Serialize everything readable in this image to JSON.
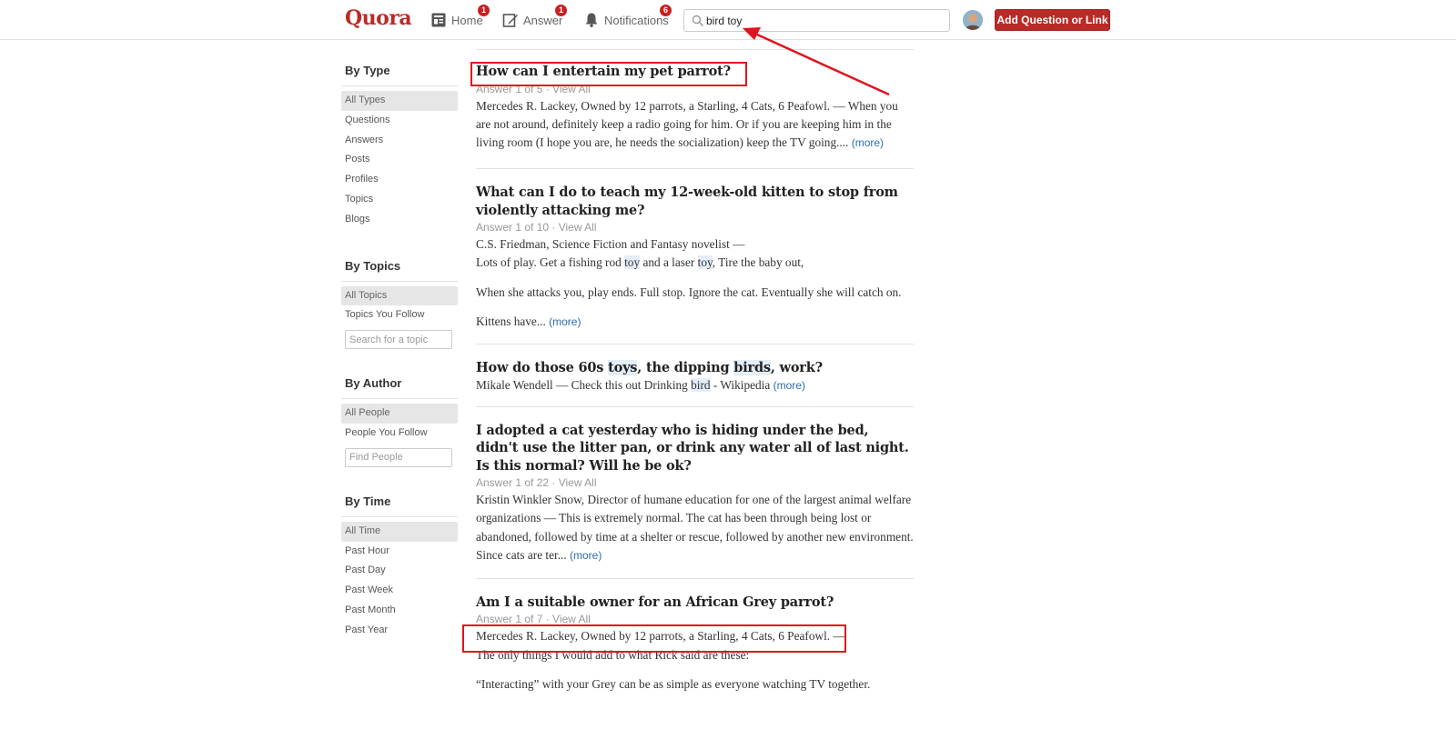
{
  "header": {
    "logo": "Quora",
    "nav": {
      "home": {
        "label": "Home",
        "badge": "1",
        "icon": "feed-icon"
      },
      "answer": {
        "label": "Answer",
        "badge": "1",
        "icon": "pencil-icon"
      },
      "notifications": {
        "label": "Notifications",
        "badge": "6",
        "icon": "bell-icon"
      }
    },
    "search": {
      "value": "bird toy",
      "icon": "search-icon"
    },
    "add_button": "Add Question or Link"
  },
  "sidebar": {
    "by_type": {
      "title": "By Type",
      "items": [
        "All Types",
        "Questions",
        "Answers",
        "Posts",
        "Profiles",
        "Topics",
        "Blogs"
      ]
    },
    "by_topics": {
      "title": "By Topics",
      "items": [
        "All Topics",
        "Topics You Follow"
      ],
      "search_placeholder": "Search for a topic"
    },
    "by_author": {
      "title": "By Author",
      "items": [
        "All People",
        "People You Follow"
      ],
      "search_placeholder": "Find People"
    },
    "by_time": {
      "title": "By Time",
      "items": [
        "All Time",
        "Past Hour",
        "Past Day",
        "Past Week",
        "Past Month",
        "Past Year"
      ]
    }
  },
  "results": [
    {
      "title": "How can I entertain my pet parrot?",
      "meta": "Answer 1 of 5 · View All",
      "author": "Mercedes R. Lackey, Owned by 12 parrots, a Starling, 4 Cats, 6 Peafowl. —",
      "text": "When you are not around, definitely keep a radio going for him. Or if you are keeping him in the living room (I hope you are, he needs the socialization) keep the TV going....",
      "more": "(more)"
    },
    {
      "title": "What can I do to teach my 12-week-old kitten to stop from violently attacking me?",
      "meta": "Answer 1 of 10 · View All",
      "author": "C.S. Friedman, Science Fiction and Fantasy novelist —",
      "line_a": "Lots of play. Get a fishing rod",
      "line_hl1": "toy",
      "line_b": "and a laser",
      "line_hl2": "toy",
      "line_c": ", Tire the baby out,",
      "para2": "When she attacks you, play ends. Full stop. Ignore the cat. Eventually she will catch on.",
      "para3": "Kittens have...",
      "more": "(more)"
    },
    {
      "title_a": "How do those 60s",
      "title_hl1": "toys",
      "title_b": ", the dipping",
      "title_hl2": "birds",
      "title_c": ", work?",
      "text_a": "Mikale Wendell — Check this out Drinking",
      "text_hl": "bird",
      "text_b": "- Wikipedia",
      "more": "(more)"
    },
    {
      "title": "I adopted a cat yesterday who is hiding under the bed, didn't use the litter pan, or drink any water all of last night. Is this normal? Will he be ok?",
      "meta": "Answer 1 of 22 · View All",
      "text": "Kristin Winkler Snow, Director of humane education for one of the largest animal welfare organizations — This is extremely normal. The cat has been through being lost or abandoned, followed by time at a shelter or rescue, followed by another new environment. Since cats are ter...",
      "more": "(more)"
    },
    {
      "title": "Am I a suitable owner for an African Grey parrot?",
      "meta": "Answer 1 of 7 · View All",
      "author": "Mercedes R. Lackey, Owned by 12 parrots, a Starling, 4 Cats, 6 Peafowl. —",
      "line2": "The only things I would add to what Rick said are these:",
      "para2": "“Interacting” with your Grey can be as simple as everyone watching TV together."
    }
  ],
  "annotation_color": "#e0141e",
  "brand_color": "#b92b27"
}
